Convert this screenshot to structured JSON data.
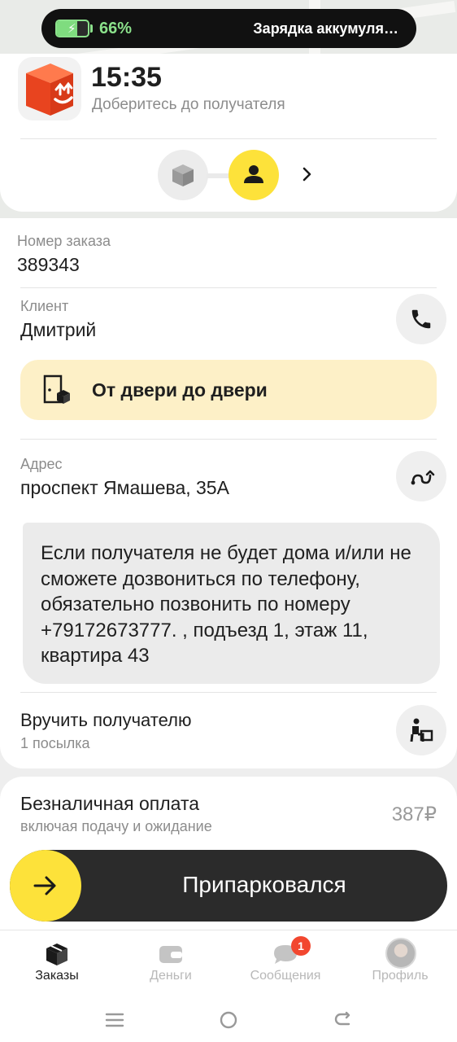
{
  "status_bar": {
    "battery_percent": "66%",
    "battery_level": 0.66,
    "notification_text": "Зарядка аккумуля…"
  },
  "header": {
    "eta_time": "15:35",
    "eta_subtitle": "Доберитесь до получателя"
  },
  "order": {
    "number_label": "Номер заказа",
    "number_value": "389343"
  },
  "client": {
    "label": "Клиент",
    "name": "Дмитрий"
  },
  "delivery_type": {
    "label": "От двери до двери"
  },
  "address": {
    "label": "Адрес",
    "value": "проспект Ямашева, 35А"
  },
  "comment": {
    "text": "Если получателя не будет дома и/или не сможете дозвониться по телефону, обязательно позвонить  по номеру +79172673777. , подъезд 1, этаж 11, квартира 43"
  },
  "handover": {
    "title": "Вручить получателю",
    "subtitle": "1 посылка"
  },
  "payment": {
    "title": "Безналичная оплата",
    "subtitle": "включая подачу и ожидание",
    "amount": "387₽"
  },
  "slider": {
    "label": "Припарковался"
  },
  "bottom_nav": {
    "items": [
      {
        "label": "Заказы",
        "icon": "orders-box-icon",
        "active": true
      },
      {
        "label": "Деньги",
        "icon": "wallet-icon",
        "active": false
      },
      {
        "label": "Сообщения",
        "icon": "chat-bubble-icon",
        "active": false,
        "badge": "1"
      },
      {
        "label": "Профиль",
        "icon": "avatar",
        "active": false
      }
    ]
  },
  "colors": {
    "accent_yellow": "#fde23a",
    "banner_yellow": "#fdf0c7",
    "badge_red": "#f2472f",
    "logo_orange": "#f04b24",
    "battery_green": "#8be18b"
  }
}
